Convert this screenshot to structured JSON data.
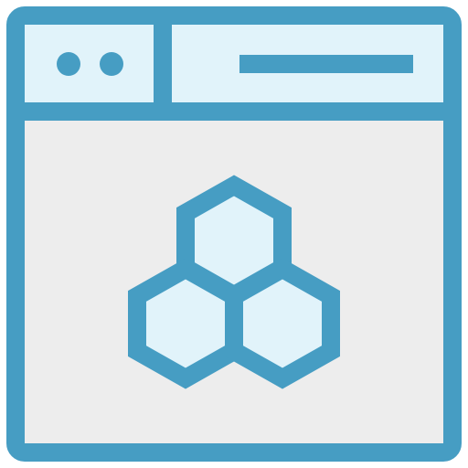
{
  "icon": {
    "name": "browser-window-hexagon-cluster-icon",
    "colors": {
      "stroke": "#469DC3",
      "header_fill": "#E1F3FA",
      "body_fill": "#EDEDED",
      "hexagon_fill": "#E1F3FA"
    }
  }
}
